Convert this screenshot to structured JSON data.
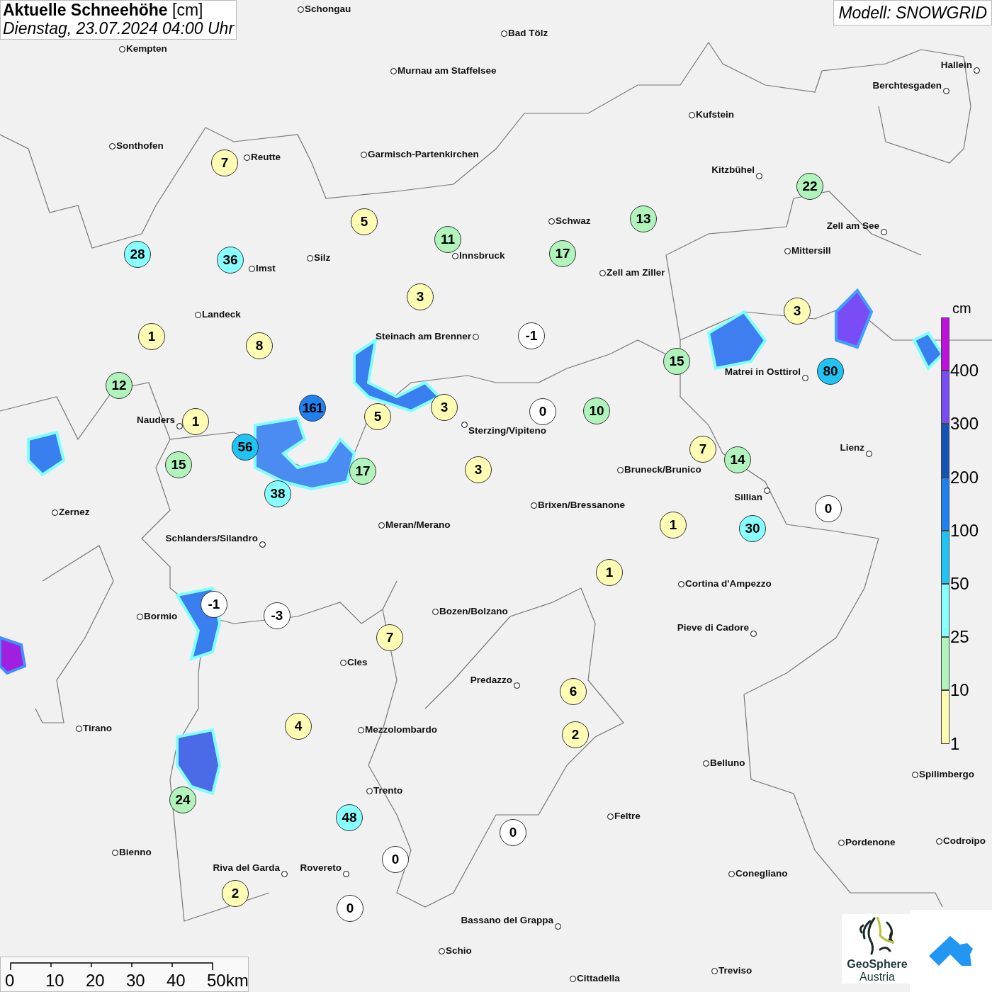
{
  "header": {
    "title": "**Aktuelle Schneehöhe** [cm]",
    "subtitle": "Dienstag, 23.07.2024 04:00 Uhr"
  },
  "model": "Modell: SNOWGRID",
  "cities": [
    "Schongau",
    "Bad Tölz",
    "Kempten",
    "Murnau am Staffelsee",
    "Hallein",
    "Berchtesgaden",
    "Kufstein",
    "Sonthofen",
    "Reutte",
    "Garmisch-Partenkirchen",
    "Kitzbühel",
    "Schwaz",
    "Zell am See",
    "Silz",
    "Innsbruck",
    "Imst",
    "Mittersill",
    "Zell am Ziller",
    "Landeck",
    "Steinach am Brenner",
    "Matrei in Osttirol",
    "Nauders",
    "Sterzing/Vipiteno",
    "Lienz",
    "Bruneck/Brunico",
    "Sillian",
    "Brixen/Bressanone",
    "Zernez",
    "Meran/Merano",
    "Schlanders/Silandro",
    "Cortina d'Ampezzo",
    "Bozen/Bolzano",
    "Bormio",
    "Pieve di Cadore",
    "Cles",
    "Predazzo",
    "Tirano",
    "Mezzolombardo",
    "Belluno",
    "Spilimbergo",
    "Trento",
    "Feltre",
    "Pordenone",
    "Codroipo",
    "Bienno",
    "Riva del Garda",
    "Rovereto",
    "Conegliano",
    "Bassano del Grappa",
    "Schio",
    "Treviso",
    "Cittadella"
  ],
  "stations": [
    "7",
    "5",
    "11",
    "17",
    "13",
    "22",
    "28",
    "36",
    "3",
    "1",
    "8",
    "-1",
    "3",
    "12",
    "161",
    "5",
    "3",
    "0",
    "10",
    "15",
    "80",
    "1",
    "56",
    "15",
    "17",
    "3",
    "38",
    "7",
    "14",
    "0",
    "1",
    "30",
    "1",
    "-1",
    "-3",
    "7",
    "6",
    "4",
    "2",
    "24",
    "48",
    "0",
    "0",
    "2",
    "0"
  ],
  "legend": {
    "unit": "cm",
    "bins": [
      {
        "label": "400",
        "color": "#c010e0"
      },
      {
        "label": "300",
        "color": "#7a4cf5"
      },
      {
        "label": "200",
        "color": "#1553b6"
      },
      {
        "label": "100",
        "color": "#2080f0"
      },
      {
        "label": "50",
        "color": "#20c4f4"
      },
      {
        "label": "25",
        "color": "#88ffff"
      },
      {
        "label": "10",
        "color": "#b0f4bc"
      },
      {
        "label": "1",
        "color": "#fffcb4"
      }
    ]
  },
  "scale_bar": [
    "0",
    "10",
    "20",
    "30",
    "40",
    "50km"
  ],
  "logo": {
    "name": "GeoSphere",
    "sub": "Austria"
  }
}
